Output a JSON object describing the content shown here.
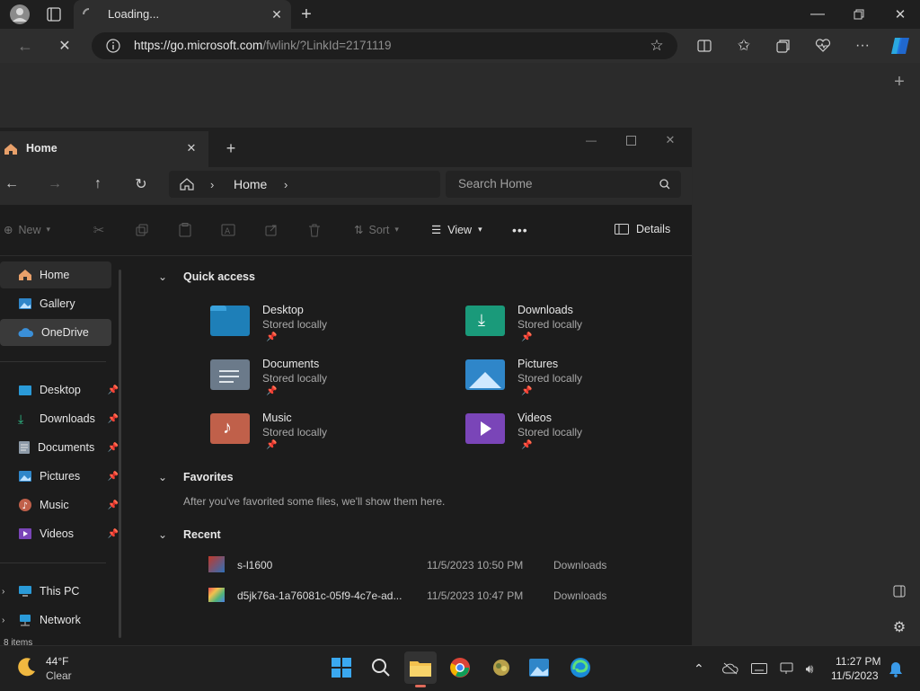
{
  "browser": {
    "tab_title": "Loading...",
    "url_host": "https://go.microsoft.com",
    "url_path": "/fwlink/?LinkId=2171119"
  },
  "explorer": {
    "tab_title": "Home",
    "breadcrumb": "Home",
    "search_placeholder": "Search Home",
    "commands": {
      "new": "New",
      "sort": "Sort",
      "view": "View",
      "details": "Details",
      "more": "•••"
    },
    "sidebar": {
      "top": [
        {
          "label": "Home"
        },
        {
          "label": "Gallery"
        },
        {
          "label": "OneDrive"
        }
      ],
      "pinned": [
        {
          "label": "Desktop"
        },
        {
          "label": "Downloads"
        },
        {
          "label": "Documents"
        },
        {
          "label": "Pictures"
        },
        {
          "label": "Music"
        },
        {
          "label": "Videos"
        }
      ],
      "bottom": [
        {
          "label": "This PC"
        },
        {
          "label": "Network"
        }
      ],
      "status": "8 items"
    },
    "quick_access": {
      "title": "Quick access",
      "items": [
        {
          "name": "Desktop",
          "sub": "Stored locally",
          "color": "#1e7fb8"
        },
        {
          "name": "Downloads",
          "sub": "Stored locally",
          "color": "#1a9a7a"
        },
        {
          "name": "Documents",
          "sub": "Stored locally",
          "color": "#6b7a8a"
        },
        {
          "name": "Pictures",
          "sub": "Stored locally",
          "color": "#2f86c9"
        },
        {
          "name": "Music",
          "sub": "Stored locally",
          "color": "#c0604a"
        },
        {
          "name": "Videos",
          "sub": "Stored locally",
          "color": "#7a45b8"
        }
      ]
    },
    "favorites": {
      "title": "Favorites",
      "empty": "After you've favorited some files, we'll show them here."
    },
    "recent": {
      "title": "Recent",
      "items": [
        {
          "name": "s-l1600",
          "date": "11/5/2023 10:50 PM",
          "location": "Downloads"
        },
        {
          "name": "d5jk76a-1a76081c-05f9-4c7e-ad...",
          "date": "11/5/2023 10:47 PM",
          "location": "Downloads"
        }
      ]
    }
  },
  "taskbar": {
    "weather_temp": "44°F",
    "weather_desc": "Clear",
    "time": "11:27 PM",
    "date": "11/5/2023"
  },
  "icons": [
    "profile-icon",
    "tab-actions-icon",
    "loading-icon",
    "close-icon",
    "new-tab-icon",
    "back-icon",
    "stop-icon",
    "info-icon",
    "favorite-star-icon",
    "split-screen-icon",
    "favorites-icon",
    "collections-icon",
    "health-icon",
    "more-icon",
    "copilot-icon",
    "folder-icon",
    "search-icon"
  ]
}
